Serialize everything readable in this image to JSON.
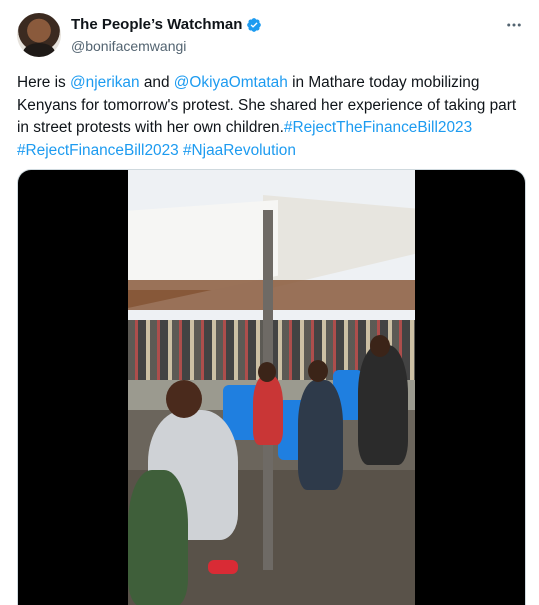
{
  "author": {
    "display_name": "The People’s Watchman",
    "handle": "@bonifacemwangi",
    "verified": true
  },
  "icons": {
    "verified": "verified-badge-icon",
    "more": "more-options-icon"
  },
  "tweet": {
    "text": {
      "t1": "Here is ",
      "m1": "@njerikan",
      "t2": " and ",
      "m2": "@OkiyaOmtatah",
      "t3": " in Mathare today mobilizing Kenyans for tomorrow's protest. She shared her experience of taking part in street protests with her own children.",
      "h1": "#RejectTheFinanceBill2023",
      "t4": " ",
      "h2": "#RejectFinanceBill2023",
      "t5": " ",
      "h3": "#NjaaRevolution"
    }
  },
  "colors": {
    "link": "#1d9bf0",
    "verified": "#1d9bf0",
    "secondary_text": "#536471"
  }
}
